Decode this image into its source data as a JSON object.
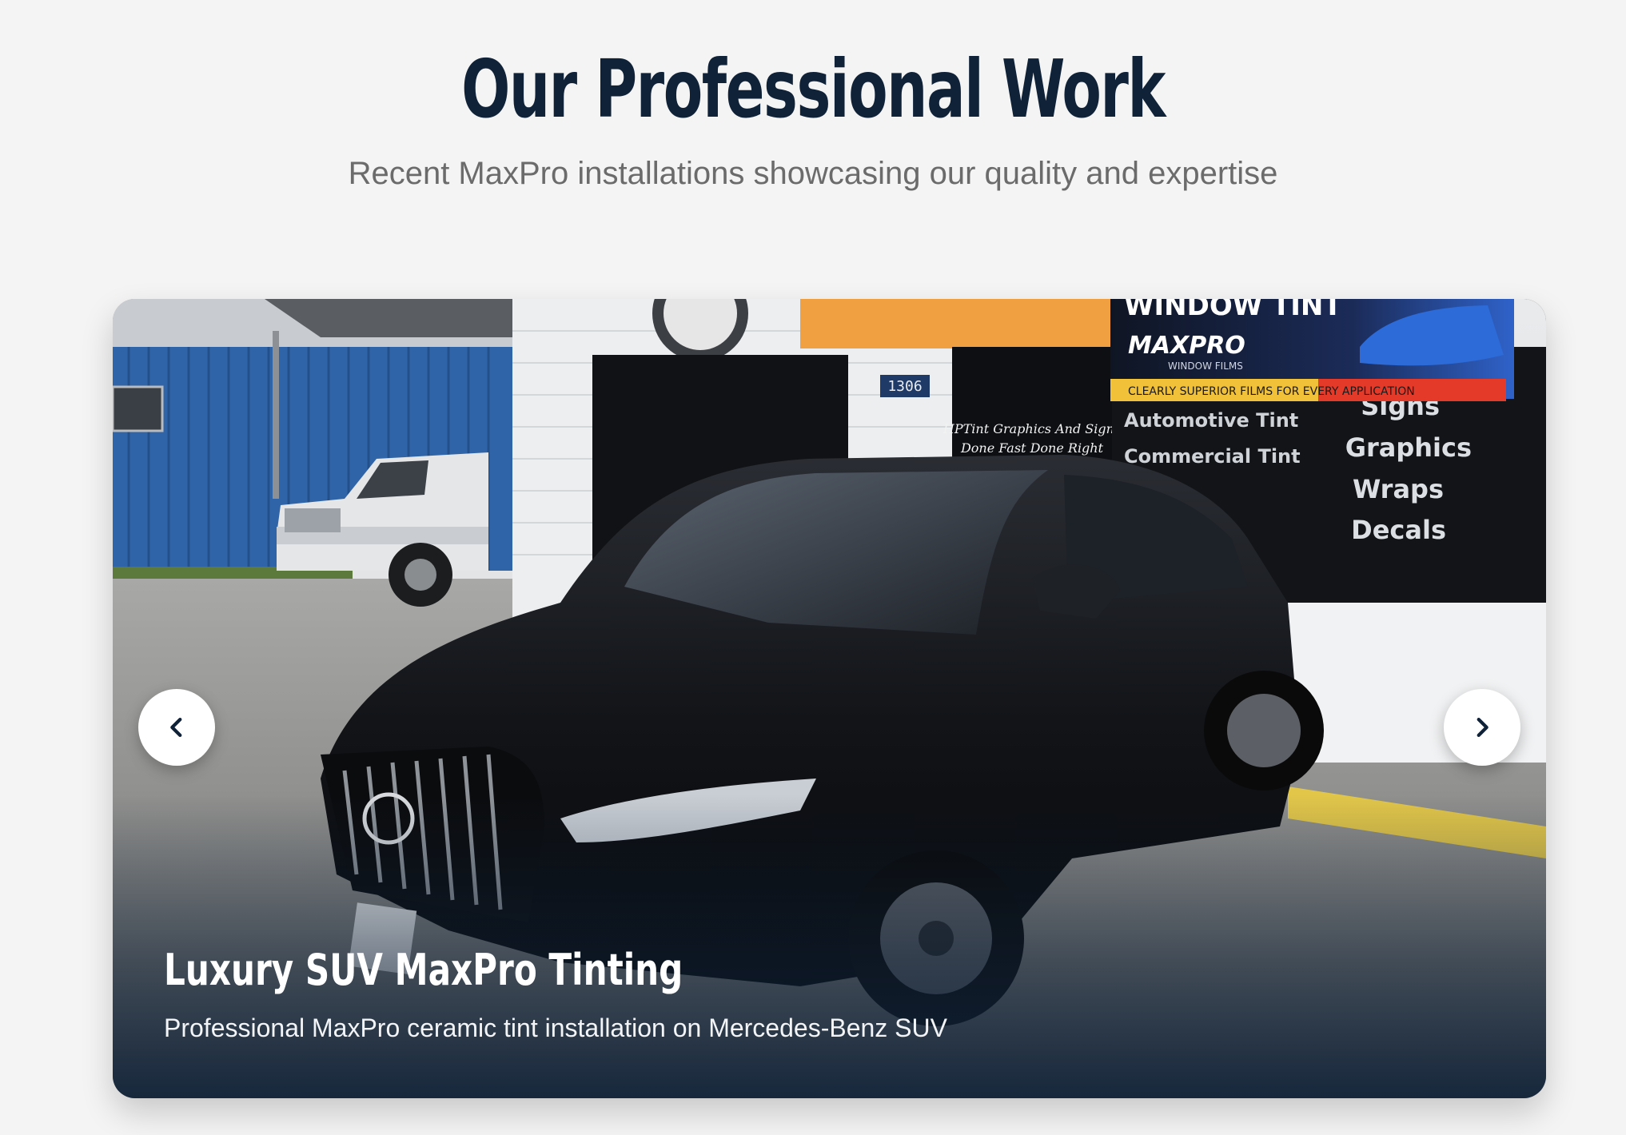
{
  "section": {
    "title": "Our Professional Work",
    "subtitle": "Recent MaxPro installations showcasing our quality and expertise"
  },
  "carousel": {
    "slide": {
      "title": "Luxury SUV MaxPro Tinting",
      "description": "Professional MaxPro ceramic tint installation on Mercedes-Benz SUV"
    },
    "prev_icon": "chevron-left-icon",
    "next_icon": "chevron-right-icon"
  },
  "photo_signage": {
    "banner_top": "WINDOW TINT",
    "banner_brand": "MAXPRO",
    "banner_brand_sub": "WINDOW FILMS",
    "banner_tagline": "CLEARLY SUPERIOR FILMS FOR EVERY APPLICATION",
    "address_number": "1306",
    "window_service_1": "Automotive Tint",
    "window_service_2": "Commercial Tint",
    "window_list": [
      "Signs",
      "Graphics",
      "Wraps",
      "Decals"
    ],
    "door_text": "HPTint Graphics And Signs",
    "door_tagline": "Done Fast Done Right"
  },
  "colors": {
    "heading": "#102238",
    "subheading": "#6b6b6b",
    "background": "#f4f4f4",
    "caption_overlay": "#102238",
    "banner_orange": "#f0a040",
    "building_blue": "#2f65a8"
  }
}
